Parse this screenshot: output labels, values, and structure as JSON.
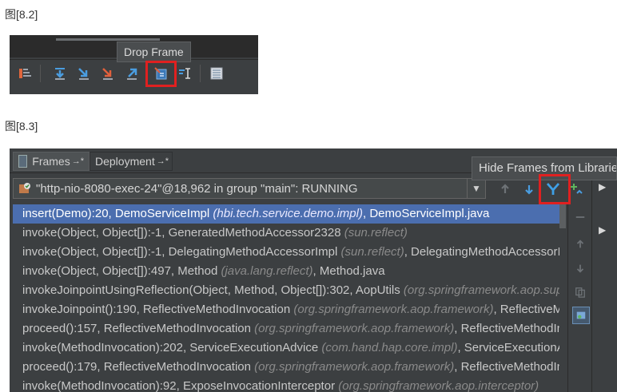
{
  "captions": {
    "fig1": "图[8.2]",
    "fig2": "图[8.3]"
  },
  "fig82": {
    "tooltip": "Drop Frame",
    "toolbar": {
      "buttons": [
        "show-execution-point-icon",
        "step-over-icon",
        "step-into-icon",
        "force-step-into-icon",
        "step-out-icon",
        "drop-frame-icon",
        "run-to-cursor-icon",
        "evaluate-expression-icon"
      ]
    }
  },
  "fig83": {
    "tabs": [
      {
        "label": "Frames",
        "pin": "→*"
      },
      {
        "label": "Deployment",
        "pin": "→*"
      }
    ],
    "thread": "\"http-nio-8080-exec-24\"@18,962 in group \"main\": RUNNING",
    "tooltip": "Hide Frames from Libraries",
    "frames": [
      {
        "method": "insert(Demo):20, DemoServiceImpl ",
        "pkg": "(hbi.tech.service.demo.impl)",
        "tail": ", DemoServiceImpl.java",
        "selected": true
      },
      {
        "method": "invoke(Object, Object[]):-1, GeneratedMethodAccessor2328 ",
        "pkg": "(sun.reflect)",
        "tail": ""
      },
      {
        "method": "invoke(Object, Object[]):-1, DelegatingMethodAccessorImpl ",
        "pkg": "(sun.reflect)",
        "tail": ", DelegatingMethodAccessorImpl"
      },
      {
        "method": "invoke(Object, Object[]):497, Method ",
        "pkg": "(java.lang.reflect)",
        "tail": ", Method.java"
      },
      {
        "method": "invokeJoinpointUsingReflection(Object, Method, Object[]):302, AopUtils ",
        "pkg": "(org.springframework.aop.support)",
        "tail": ""
      },
      {
        "method": "invokeJoinpoint():190, ReflectiveMethodInvocation ",
        "pkg": "(org.springframework.aop.framework)",
        "tail": ", ReflectiveMethodInvocation"
      },
      {
        "method": "proceed():157, ReflectiveMethodInvocation ",
        "pkg": "(org.springframework.aop.framework)",
        "tail": ", ReflectiveMethodInvocation"
      },
      {
        "method": "invoke(MethodInvocation):202, ServiceExecutionAdvice ",
        "pkg": "(com.hand.hap.core.impl)",
        "tail": ", ServiceExecutionAdvice"
      },
      {
        "method": "proceed():179, ReflectiveMethodInvocation ",
        "pkg": "(org.springframework.aop.framework)",
        "tail": ", ReflectiveMethodInvocation"
      },
      {
        "method": "invoke(MethodInvocation):92, ExposeInvocationInterceptor ",
        "pkg": "(org.springframework.aop.interceptor)",
        "tail": ""
      }
    ]
  },
  "colors": {
    "highlight": "#e02020",
    "selection": "#4b6eaf",
    "panel": "#3c3f41"
  }
}
